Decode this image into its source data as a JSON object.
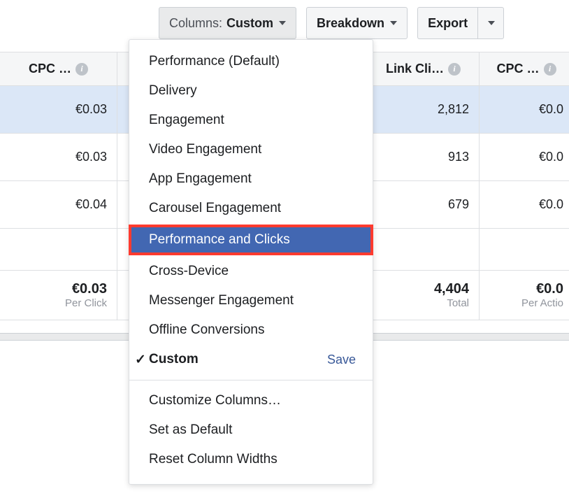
{
  "toolbar": {
    "columns_prefix": "Columns:",
    "columns_value": "Custom",
    "breakdown": "Breakdown",
    "export": "Export"
  },
  "columns": {
    "c0": "CPC …",
    "c1": "",
    "c2": "",
    "c3": "Link Cli…",
    "c4": "CPC …"
  },
  "rows": [
    {
      "c0": "€0.03",
      "c3": "2,812",
      "c4": "€0.0"
    },
    {
      "c0": "€0.03",
      "c3": "913",
      "c4": "€0.0"
    },
    {
      "c0": "€0.04",
      "c3": "679",
      "c4": "€0.0"
    }
  ],
  "summary": {
    "c0_main": "€0.03",
    "c0_sub": "Per Click",
    "c3_main": "4,404",
    "c3_sub": "Total",
    "c4_main": "€0.0",
    "c4_sub": "Per Actio"
  },
  "dropdown": {
    "items": [
      "Performance (Default)",
      "Delivery",
      "Engagement",
      "Video Engagement",
      "App Engagement",
      "Carousel Engagement",
      "Performance and Clicks",
      "Cross-Device",
      "Messenger Engagement",
      "Offline Conversions"
    ],
    "selected": "Custom",
    "save_label": "Save",
    "actions": [
      "Customize Columns…",
      "Set as Default",
      "Reset Column Widths"
    ]
  }
}
